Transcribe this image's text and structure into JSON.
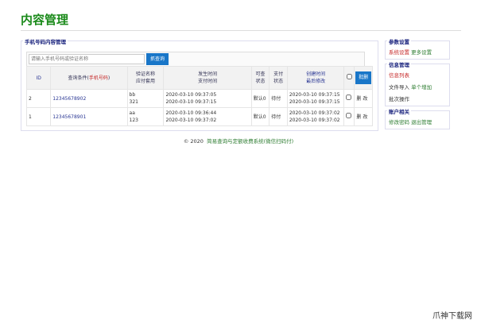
{
  "title": "内容管理",
  "main": {
    "legend": "手机号码内容管理",
    "search_placeholder": "请输入手机号码或验证名称",
    "search_button": "抓查询",
    "headers": {
      "id": "ID",
      "cond": "查询条件(",
      "cond_red": "手机号码",
      "cond_end": ")",
      "name1": "验证名称",
      "name2": "应付套用",
      "t1": "发生时间",
      "t2": "支付时间",
      "s1": "可查",
      "s2": "状态",
      "p1": "支付",
      "p2": "状态",
      "c1": "创建时间",
      "c2": "最后修改",
      "batch": "批删"
    },
    "rows": [
      {
        "id": "2",
        "phone": "12345678902",
        "name": "bb",
        "amount": "321",
        "occur": "2020-03-10 09:37:05",
        "pay": "2020-03-10 09:37:15",
        "state": "默认0",
        "paystate": "待付",
        "created": "2020-03-10 09:37:15",
        "modified": "2020-03-10 09:37:15",
        "del": "删",
        "edit": "改"
      },
      {
        "id": "1",
        "phone": "12345678901",
        "name": "aa",
        "amount": "123",
        "occur": "2020-03-10 09:36:44",
        "pay": "2020-03-10 09:37:02",
        "state": "默认0",
        "paystate": "待付",
        "created": "2020-03-10 09:37:02",
        "modified": "2020-03-10 09:37:02",
        "del": "删",
        "edit": "改"
      }
    ]
  },
  "side": {
    "params": "参数设置",
    "sys": "系统设置",
    "more": "更多设置",
    "info": "信息管理",
    "list": "信息列表",
    "import": "文件导入",
    "add": "单个增加",
    "batch": "批次操作",
    "account": "账户相关",
    "pwd": "修改密码",
    "logout": "退出管理"
  },
  "footer": {
    "copy": "© 2020",
    "link": "简易查询与定额收费系统(微信扫码付)"
  },
  "watermark": "爪神下载网"
}
